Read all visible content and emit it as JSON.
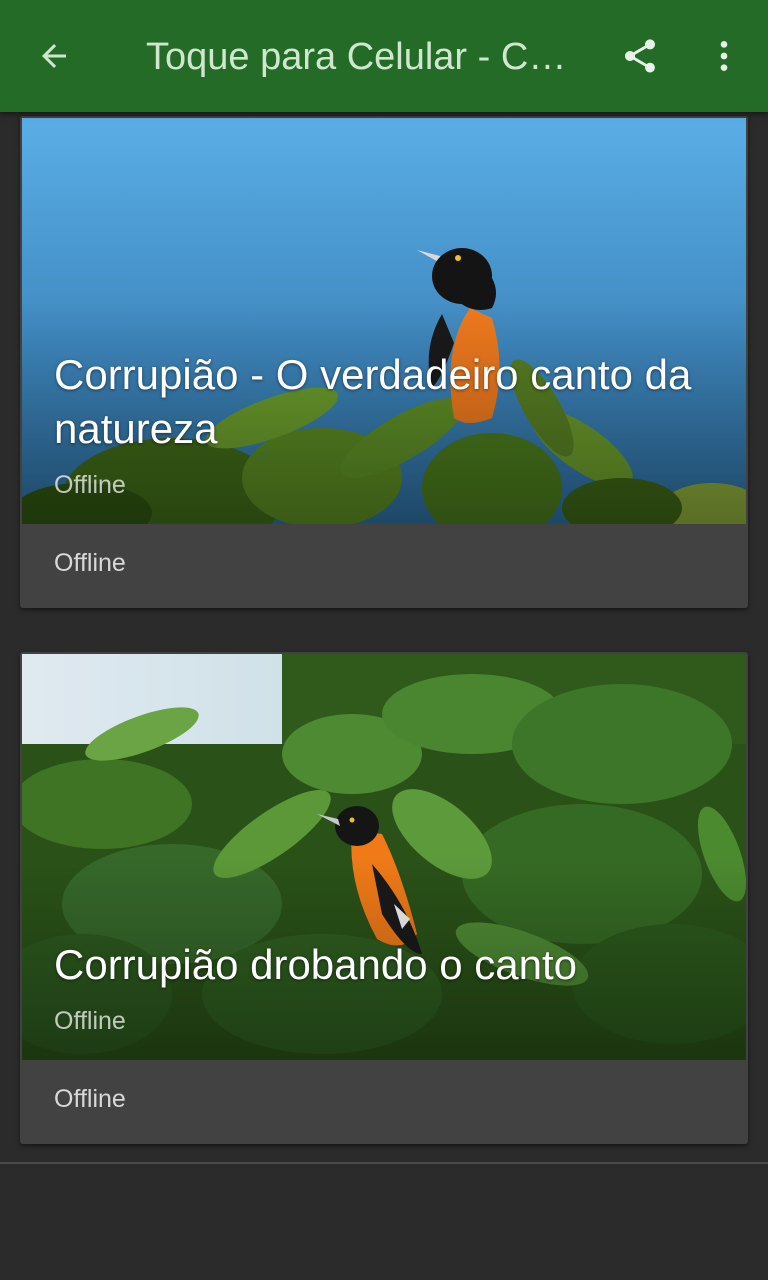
{
  "app_bar": {
    "title": "Toque para Celular - Corrupião",
    "background": "#236b27",
    "icons": [
      "back-arrow-icon",
      "share-icon",
      "more-vertical-icon"
    ]
  },
  "cards": [
    {
      "title": "Corrupião - O verdadeiro canto da natureza",
      "subtitle": "Offline",
      "footer": "Offline"
    },
    {
      "title": "Corrupião drobando o canto",
      "subtitle": "Offline",
      "footer": "Offline"
    }
  ]
}
